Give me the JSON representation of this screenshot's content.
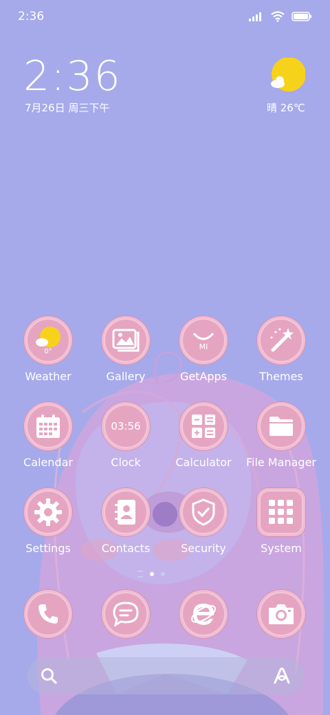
{
  "status_bar": {
    "time": "2:36"
  },
  "clock_widget": {
    "time": "2:36",
    "date": "7月26日 周三下午",
    "weather": "晴 26℃"
  },
  "apps": [
    {
      "label": "Weather",
      "icon": "weather-icon",
      "temp": "0°"
    },
    {
      "label": "Gallery",
      "icon": "gallery-icon"
    },
    {
      "label": "GetApps",
      "icon": "getapps-icon",
      "mark": "MI"
    },
    {
      "label": "Themes",
      "icon": "magic-wand-icon"
    },
    {
      "label": "Calendar",
      "icon": "calendar-icon"
    },
    {
      "label": "Clock",
      "icon": "clock-icon",
      "time": "03:56"
    },
    {
      "label": "Calculator",
      "icon": "calculator-icon"
    },
    {
      "label": "File Manager",
      "icon": "folder-icon"
    },
    {
      "label": "Settings",
      "icon": "gear-icon"
    },
    {
      "label": "Contacts",
      "icon": "contacts-icon"
    },
    {
      "label": "Security",
      "icon": "shield-icon"
    },
    {
      "label": "System",
      "icon": "system-folder-icon"
    }
  ],
  "dock": [
    {
      "icon": "phone-icon"
    },
    {
      "icon": "messages-icon"
    },
    {
      "icon": "browser-icon"
    },
    {
      "icon": "camera-icon"
    }
  ],
  "colors": {
    "background": "#a6aaea",
    "icon_pink": "#e6aac4",
    "sun": "#f7d21a"
  }
}
